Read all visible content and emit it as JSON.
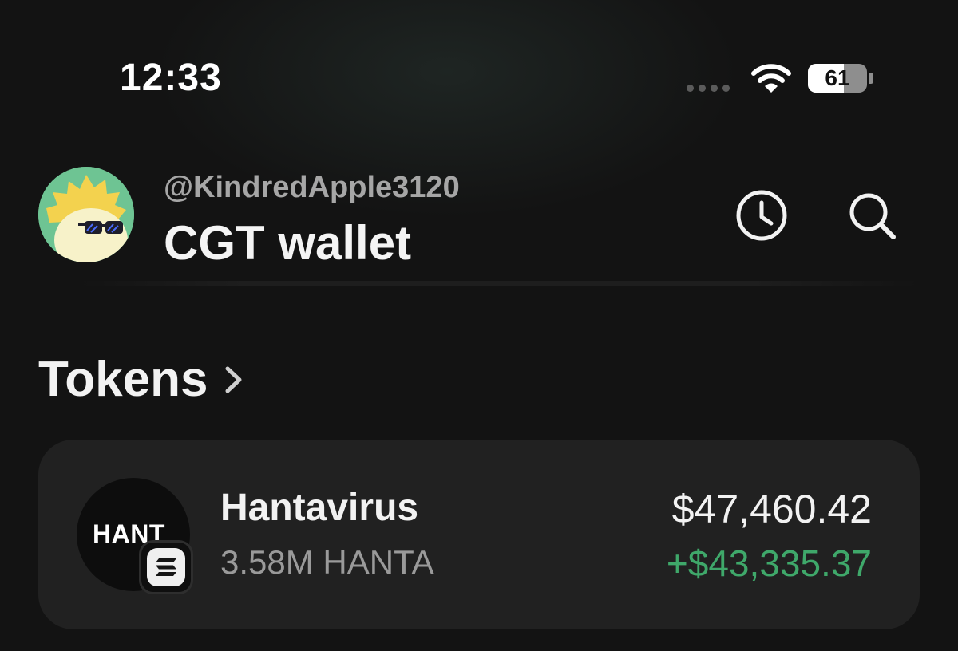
{
  "status_bar": {
    "time": "12:33",
    "battery_level": "61",
    "battery_fraction": 0.61,
    "icons": [
      "signal-dots-icon",
      "wifi-icon",
      "battery-icon"
    ]
  },
  "header": {
    "username": "@KindredApple3120",
    "wallet_name": "CGT wallet",
    "avatar_icon": "avatar-icon",
    "history_icon": "clock-icon",
    "search_icon": "search-icon"
  },
  "tokens_section": {
    "title": "Tokens",
    "chevron_icon": "chevron-right-icon",
    "items": [
      {
        "logo_text": "HANT",
        "name": "Hantavirus",
        "amount": "3.58M HANTA",
        "value": "$47,460.42",
        "change": "+$43,335.37",
        "change_color": "#3fa86a",
        "chain_badge_icon": "solana-icon"
      }
    ]
  }
}
